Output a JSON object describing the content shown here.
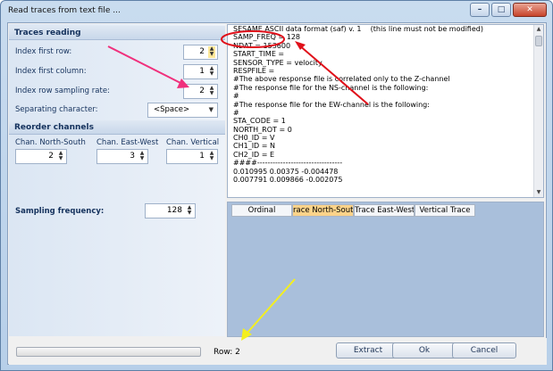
{
  "window": {
    "title": "Read traces from text file ..."
  },
  "titlebar_buttons": {
    "minimize": "–",
    "maximize": "□",
    "close": "✕"
  },
  "traces_reading": {
    "header": "Traces reading",
    "index_first_row": {
      "label": "Index first row:",
      "value": "2"
    },
    "index_first_column": {
      "label": "Index first column:",
      "value": "1"
    },
    "index_row_sampling_rate": {
      "label": "Index row sampling rate:",
      "value": "2"
    },
    "separating_character": {
      "label": "Separating character:",
      "value": "<Space>"
    }
  },
  "reorder_channels": {
    "header": "Reorder channels",
    "north_south": {
      "label": "Chan. North-South",
      "value": "2"
    },
    "east_west": {
      "label": "Chan. East-West",
      "value": "3"
    },
    "vertical": {
      "label": "Chan. Vertical",
      "value": "1"
    }
  },
  "sampling_frequency": {
    "label": "Sampling frequency:",
    "value": "128"
  },
  "text_preview": {
    "lines": [
      "SESAME ASCII data format (saf) v. 1    (this line must not be modified)",
      "SAMP_FREQ = 128",
      "NDAT = 153600",
      "START_TIME =",
      "SENSOR_TYPE = velocity",
      "RESPFILE =",
      "#The above response file is correlated only to the Z-channel",
      "#The response file for the NS-channel is the following:",
      "#",
      "#The response file for the EW-channel is the following:",
      "#",
      "STA_CODE = 1",
      "NORTH_ROT = 0",
      "CH0_ID = V",
      "CH1_ID = N",
      "CH2_ID = E",
      "####---------------------------------",
      "0.010995 0.00375 -0.004478",
      "0.007791 0.009866 -0.002075"
    ]
  },
  "grid": {
    "columns": [
      "Ordinal",
      "race North-South",
      "Trace East-West",
      "Vertical Trace"
    ]
  },
  "status": {
    "row": "Row: 2"
  },
  "buttons": {
    "extract": "Extract",
    "ok": "Ok",
    "cancel": "Cancel"
  },
  "annotation_colors": {
    "red": "#e0101a",
    "pink": "#f0307c",
    "yellow": "#f4ef1e"
  },
  "icons": {
    "spin": "spin-updown-icon",
    "dropdown": "chevron-down-icon"
  }
}
